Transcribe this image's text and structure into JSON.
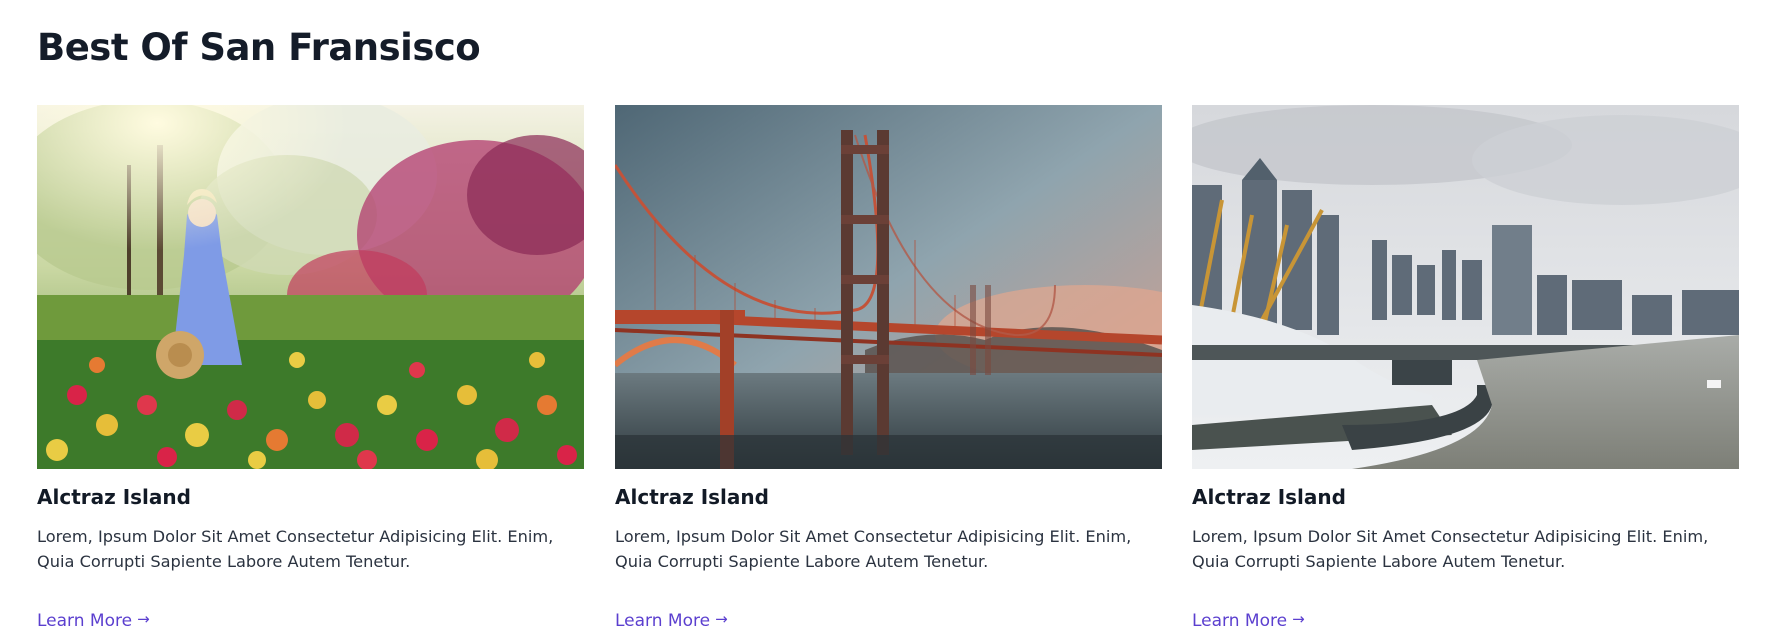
{
  "section": {
    "title": "Best Of San Fransisco"
  },
  "cards": [
    {
      "image": "tulip-garden-photo",
      "title": "Alctraz Island",
      "text": "Lorem, Ipsum Dolor Sit Amet Consectetur Adipisicing Elit. Enim, Quia Corrupti Sapiente Labore Autem Tenetur.",
      "link_label": "Learn More",
      "link_icon": "arrow-right-icon"
    },
    {
      "image": "golden-gate-bridge-photo",
      "title": "Alctraz Island",
      "text": "Lorem, Ipsum Dolor Sit Amet Consectetur Adipisicing Elit. Enim, Quia Corrupti Sapiente Labore Autem Tenetur.",
      "link_label": "Learn More",
      "link_icon": "arrow-right-icon"
    },
    {
      "image": "city-waterfront-photo",
      "title": "Alctraz Island",
      "text": "Lorem, Ipsum Dolor Sit Amet Consectetur Adipisicing Elit. Enim, Quia Corrupti Sapiente Labore Autem Tenetur.",
      "link_label": "Learn More",
      "link_icon": "arrow-right-icon"
    }
  ],
  "colors": {
    "heading": "#141c29",
    "body_text": "#2b3340",
    "link": "#5b3fcf",
    "background": "#ffffff"
  }
}
